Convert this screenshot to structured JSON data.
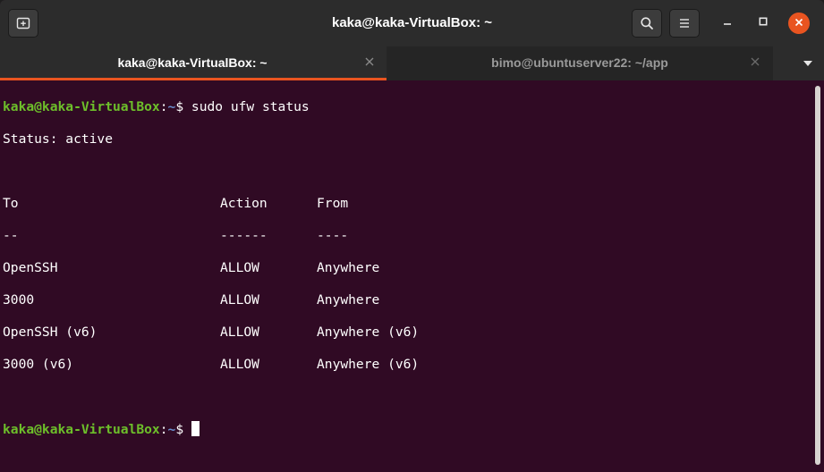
{
  "window": {
    "title": "kaka@kaka-VirtualBox: ~"
  },
  "tabs": [
    {
      "label": "kaka@kaka-VirtualBox: ~",
      "active": true
    },
    {
      "label": "bimo@ubuntuserver22: ~/app",
      "active": false
    }
  ],
  "icons": {
    "new_tab": "new-tab-icon",
    "search": "search-icon",
    "menu": "hamburger-menu-icon",
    "minimize": "minimize-icon",
    "maximize": "maximize-icon",
    "close": "close-icon",
    "tab_close": "close-icon",
    "tabs_menu": "chevron-down-icon"
  },
  "colors": {
    "terminal_bg": "#300a24",
    "accent": "#e95420",
    "prompt_user": "#6dbf2a",
    "prompt_path": "#6a8fce"
  },
  "terminal": {
    "prompt_user": "kaka@kaka-VirtualBox",
    "prompt_sep": ":",
    "prompt_path": "~",
    "prompt_symbol": "$ ",
    "command": "sudo ufw status",
    "status_line": "Status: active",
    "table_header": {
      "to": "To",
      "action": "Action",
      "from": "From"
    },
    "table_rule": {
      "to": "--",
      "action": "------",
      "from": "----"
    },
    "rules": [
      {
        "to": "OpenSSH",
        "action": "ALLOW",
        "from": "Anywhere"
      },
      {
        "to": "3000",
        "action": "ALLOW",
        "from": "Anywhere"
      },
      {
        "to": "OpenSSH (v6)",
        "action": "ALLOW",
        "from": "Anywhere (v6)"
      },
      {
        "to": "3000 (v6)",
        "action": "ALLOW",
        "from": "Anywhere (v6)"
      }
    ]
  }
}
